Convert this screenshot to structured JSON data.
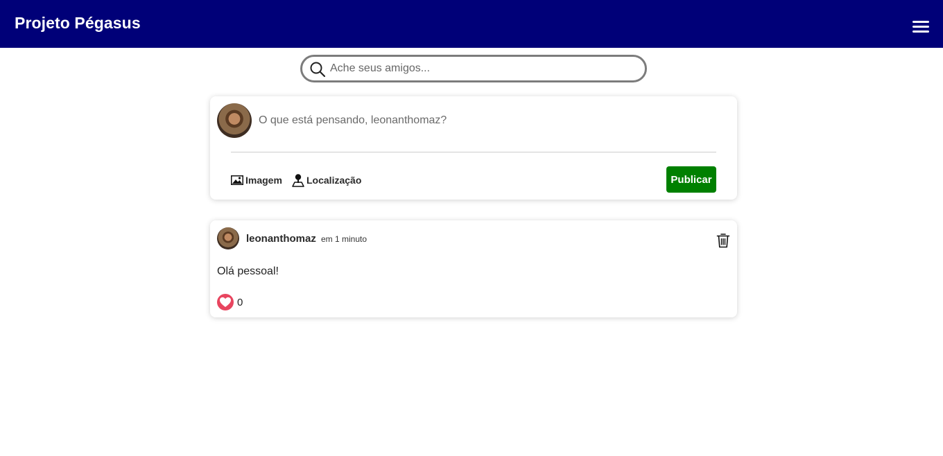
{
  "header": {
    "title": "Projeto Pégasus",
    "menu_icon": "hamburger-menu-icon"
  },
  "search": {
    "placeholder": "Ache seus amigos...",
    "value": "",
    "icon": "search-icon"
  },
  "composer": {
    "placeholder": "O que está pensando, leonanthomaz?",
    "value": "",
    "image_label": "Imagem",
    "location_label": "Localização",
    "publish_label": "Publicar",
    "publish_color": "#008000"
  },
  "post": {
    "author": "leonanthomaz",
    "time": "em 1 minuto",
    "text": "Olá pessoal!",
    "likes": "0",
    "like_color": "#e8455f"
  },
  "colors": {
    "header_bg": "#000078",
    "accent_green": "#008000"
  }
}
